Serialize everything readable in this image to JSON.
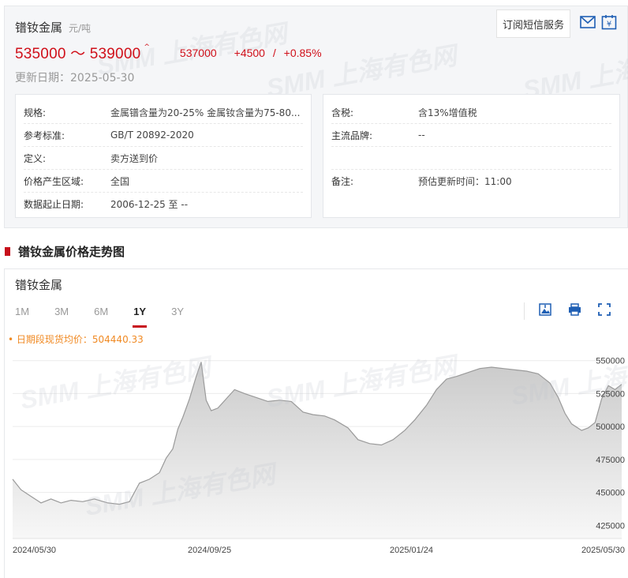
{
  "header": {
    "name": "镨钕金属",
    "unit": "元/吨",
    "price_range": "535000 ～ 539000",
    "avg_price": "537000",
    "change": "+4500",
    "change_sep": "/",
    "change_pct": "+0.85%",
    "update_date": "更新日期：2025-05-30",
    "subscribe_label": "订阅短信服务",
    "watermark": "SMM 上海有色网"
  },
  "info_left": [
    {
      "label": "规格:",
      "value": "金属镨含量为20-25% 金属钕含量为75-80..."
    },
    {
      "label": "参考标准:",
      "value": "GB/T 20892-2020"
    },
    {
      "label": "定义:",
      "value": "卖方送到价"
    },
    {
      "label": "价格产生区域:",
      "value": "全国"
    },
    {
      "label": "数据起止日期:",
      "value": "2006-12-25 至 --"
    }
  ],
  "info_right": [
    {
      "label": "含税:",
      "value": "含13%增值税"
    },
    {
      "label": "主流品牌:",
      "value": "--"
    },
    {
      "label": "",
      "value": ""
    },
    {
      "label": "备注:",
      "value": "预估更新时间：11:00"
    }
  ],
  "section": {
    "title": "镨钕金属价格走势图"
  },
  "chart_panel": {
    "name": "镨钕金属",
    "tabs": [
      "1M",
      "3M",
      "6M",
      "1Y",
      "3Y"
    ],
    "active_tab": "1Y",
    "legend": "• 日期段现货均价：504440.33"
  },
  "colors": {
    "accent": "#c70f1c",
    "legend": "#f08a24",
    "line": "#9a9a9a"
  },
  "chart_data": {
    "type": "area",
    "y_axis_side": "right",
    "ylim": [
      415000,
      560000
    ],
    "yticks": [
      425000,
      450000,
      475000,
      500000,
      525000,
      550000
    ],
    "ytick_labels": [
      "425000",
      "450000",
      "475000",
      "500000",
      "525000",
      "550000"
    ],
    "xlim": [
      "2024-05-30",
      "2025-05-30"
    ],
    "xtick_labels": [
      "2024/05/30",
      "2024/09/25",
      "2025/01/24",
      "2025/05/30"
    ],
    "x": [
      "2024-05-30",
      "2024-06-04",
      "2024-06-10",
      "2024-06-16",
      "2024-06-22",
      "2024-06-28",
      "2024-07-04",
      "2024-07-11",
      "2024-07-18",
      "2024-07-26",
      "2024-08-02",
      "2024-08-08",
      "2024-08-14",
      "2024-08-20",
      "2024-08-26",
      "2024-08-30",
      "2024-09-03",
      "2024-09-06",
      "2024-09-09",
      "2024-09-13",
      "2024-09-17",
      "2024-09-20",
      "2024-09-23",
      "2024-09-26",
      "2024-09-30",
      "2024-10-05",
      "2024-10-10",
      "2024-10-16",
      "2024-10-23",
      "2024-10-30",
      "2024-11-06",
      "2024-11-13",
      "2024-11-20",
      "2024-11-26",
      "2024-12-03",
      "2024-12-09",
      "2024-12-17",
      "2024-12-23",
      "2024-12-30",
      "2025-01-06",
      "2025-01-13",
      "2025-01-20",
      "2025-01-26",
      "2025-02-02",
      "2025-02-08",
      "2025-02-14",
      "2025-02-20",
      "2025-02-27",
      "2025-03-06",
      "2025-03-13",
      "2025-03-20",
      "2025-03-27",
      "2025-04-03",
      "2025-04-10",
      "2025-04-17",
      "2025-04-22",
      "2025-04-26",
      "2025-04-30",
      "2025-05-06",
      "2025-05-10",
      "2025-05-14",
      "2025-05-18",
      "2025-05-22",
      "2025-05-26",
      "2025-05-30"
    ],
    "y": [
      460000,
      452000,
      447000,
      442000,
      445000,
      442000,
      444000,
      443000,
      445000,
      442000,
      441000,
      443000,
      457000,
      460000,
      465000,
      476000,
      483000,
      498000,
      507000,
      521000,
      538000,
      549000,
      520000,
      512000,
      514000,
      521000,
      528000,
      525000,
      522000,
      519000,
      520000,
      519000,
      511000,
      509000,
      508000,
      505000,
      499000,
      490000,
      487000,
      486000,
      490000,
      497000,
      505000,
      516000,
      528000,
      536000,
      538000,
      541000,
      544000,
      545000,
      544000,
      543000,
      542000,
      540000,
      533000,
      522000,
      510000,
      502000,
      497000,
      499000,
      503000,
      521000,
      531000,
      528000,
      532000
    ]
  }
}
